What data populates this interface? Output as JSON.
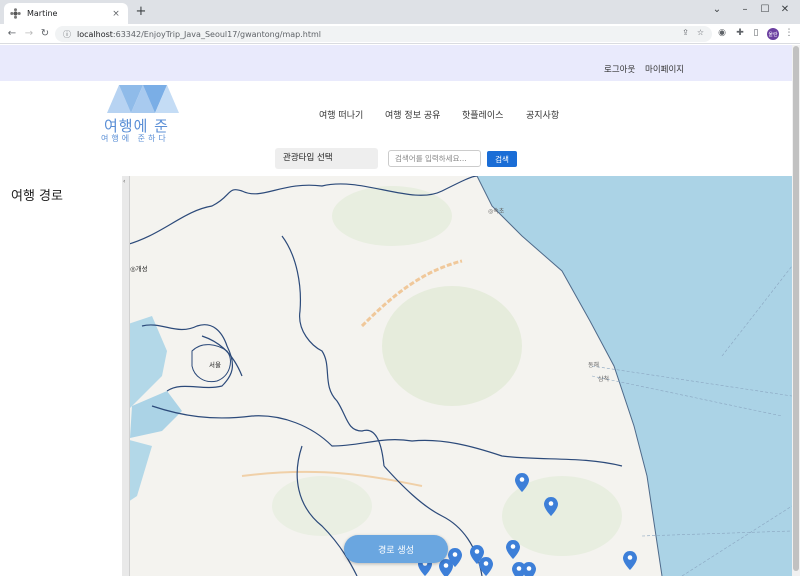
{
  "browser": {
    "tab_title": "Martine",
    "tab_close": "×",
    "new_tab": "+",
    "url_host": "localhost",
    "url_path": ":63342/EnjoyTrip_Java_Seoul17/gwantong/map.html",
    "profile_initials": "울란"
  },
  "header": {
    "logout": "로그아웃",
    "mypage": "마이페이지"
  },
  "logo": {
    "name": "여행에 준",
    "tagline": "여행에 준하다",
    "color": "#5b8fd6"
  },
  "nav": {
    "items": [
      "여행 떠나기",
      "여행 정보 공유",
      "핫플레이스",
      "공지사항"
    ]
  },
  "search": {
    "type_select": "관광타입 선택",
    "placeholder": "검색어를 입력하세요...",
    "button": "검색"
  },
  "sidebar": {
    "title": "여행 경로"
  },
  "map": {
    "cities": {
      "kaesong": "◎개성",
      "seoul": "서울",
      "sokcho": "◎속초",
      "donghae": "동해",
      "samcheok": "삼척"
    },
    "sea_color": "#abd3e6",
    "marker_color": "#3d7fd8"
  },
  "route_button": "경로 생성"
}
